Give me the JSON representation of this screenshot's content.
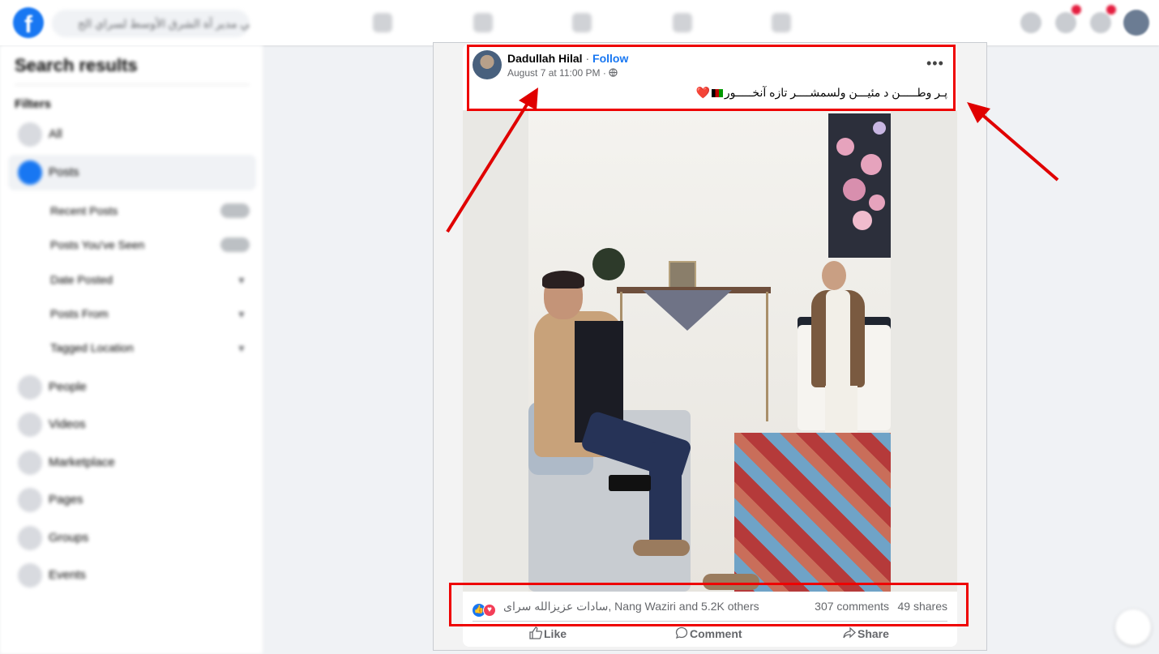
{
  "topbar": {
    "search_placeholder": "ہ عالي مدير آة الشرق الأوسط لسراي الح"
  },
  "sidebar": {
    "title": "Search results",
    "filters_label": "Filters",
    "items": [
      {
        "label": "All",
        "icon": "grid-icon"
      },
      {
        "label": "Posts",
        "icon": "posts-icon"
      }
    ],
    "sub_items": [
      {
        "label": "Recent Posts",
        "control": "toggle"
      },
      {
        "label": "Posts You've Seen",
        "control": "toggle"
      },
      {
        "label": "Date Posted",
        "control": "chevron"
      },
      {
        "label": "Posts From",
        "control": "chevron"
      },
      {
        "label": "Tagged Location",
        "control": "chevron"
      }
    ],
    "more_items": [
      {
        "label": "People",
        "icon": "people-icon"
      },
      {
        "label": "Videos",
        "icon": "videos-icon"
      },
      {
        "label": "Marketplace",
        "icon": "marketplace-icon"
      },
      {
        "label": "Pages",
        "icon": "pages-icon"
      },
      {
        "label": "Groups",
        "icon": "groups-icon"
      },
      {
        "label": "Events",
        "icon": "events-icon"
      }
    ]
  },
  "post": {
    "author": "Dadullah Hilal",
    "separator": " · ",
    "follow_label": "Follow",
    "timestamp": "August 7 at 11:00 PM",
    "audience_icon": "globe-icon",
    "more_icon": "more-dots-icon",
    "more_symbol": "•••",
    "caption": "پـر وطـــــن د مئيـــن ولسمشــــر تازه آنخـــــور",
    "caption_heart": "❤️",
    "reactions_icons": [
      "like-reaction-icon",
      "love-reaction-icon"
    ],
    "reactions_text": "سادات عزيزالله سراى, Nang Waziri and 5.2K others",
    "comments": "307 comments",
    "shares": "49 shares",
    "actions": [
      {
        "label": "Like",
        "icon": "thumbs-up-icon"
      },
      {
        "label": "Comment",
        "icon": "comment-icon"
      },
      {
        "label": "Share",
        "icon": "share-icon"
      }
    ]
  },
  "colors": {
    "accent": "#1877f2",
    "annotation_red": "#e00000",
    "love": "#f33e58"
  }
}
